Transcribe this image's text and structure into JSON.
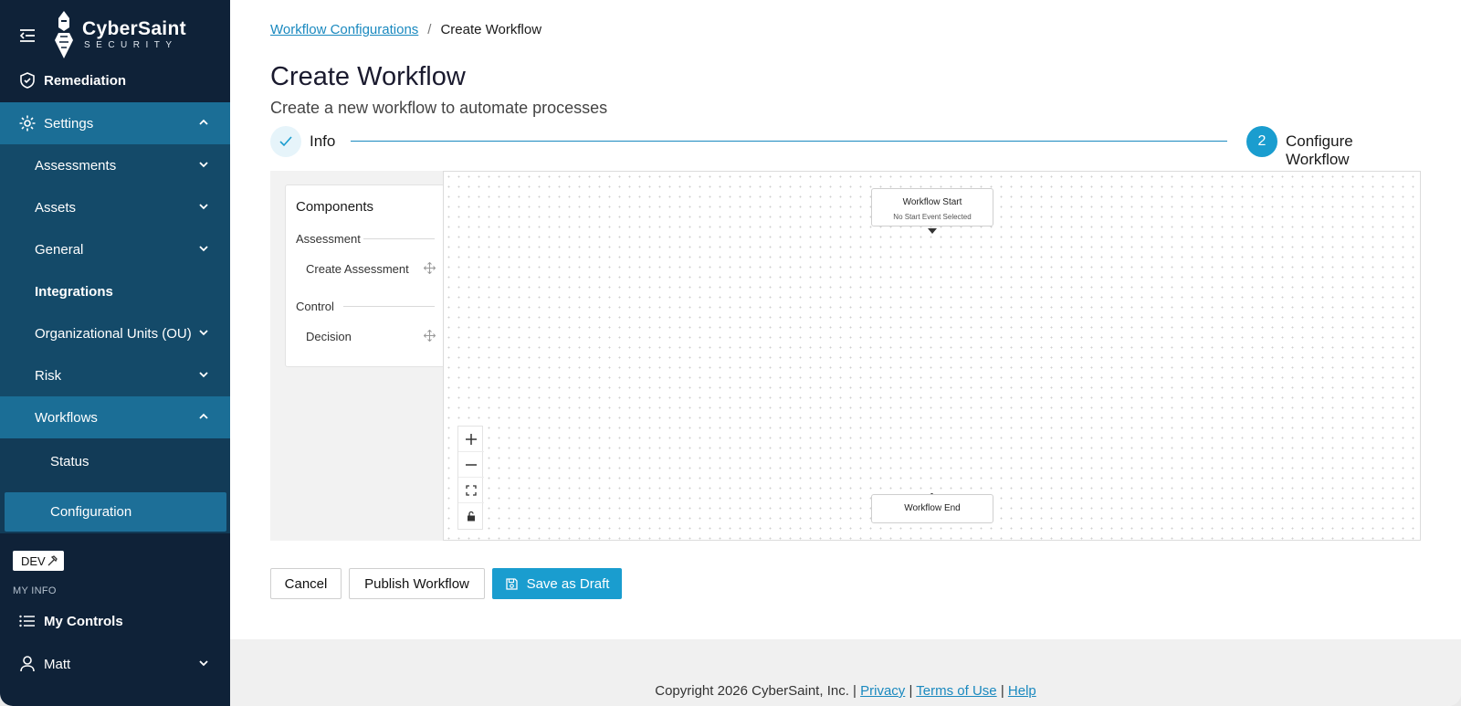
{
  "logo": {
    "name": "CyberSaint",
    "tagline": "SECURITY"
  },
  "sidebar": {
    "items": [
      {
        "label": "Remediation",
        "icon": "shield-check-icon"
      },
      {
        "label": "Settings",
        "icon": "gear-icon"
      },
      {
        "label": "Assessments"
      },
      {
        "label": "Assets"
      },
      {
        "label": "General"
      },
      {
        "label": "Integrations"
      },
      {
        "label": "Organizational Units (OU)"
      },
      {
        "label": "Risk"
      },
      {
        "label": "Workflows"
      },
      {
        "label": "Status"
      },
      {
        "label": "Configuration"
      },
      {
        "label": "My Controls",
        "icon": "list-icon"
      },
      {
        "label": "Matt",
        "icon": "user-icon"
      }
    ],
    "env_badge": "DEV",
    "section_label": "MY INFO"
  },
  "breadcrumb": {
    "parent": "Workflow Configurations",
    "separator": "/",
    "current": "Create Workflow"
  },
  "page": {
    "title": "Create Workflow",
    "subtitle": "Create a new workflow to automate processes"
  },
  "stepper": {
    "steps": [
      {
        "label": "Info",
        "state": "complete"
      },
      {
        "number": "2",
        "label": "Configure Workflow",
        "state": "active"
      }
    ]
  },
  "components": {
    "title": "Components",
    "groups": [
      {
        "category": "Assessment",
        "items": [
          "Create Assessment"
        ]
      },
      {
        "category": "Control",
        "items": [
          "Decision"
        ]
      }
    ]
  },
  "canvas": {
    "start_node": {
      "title": "Workflow Start",
      "subtitle": "No Start Event Selected"
    },
    "end_node": {
      "title": "Workflow End"
    }
  },
  "actions": {
    "cancel": "Cancel",
    "publish": "Publish Workflow",
    "save_draft": "Save as Draft"
  },
  "footer": {
    "copyright": "Copyright 2026 CyberSaint, Inc. |",
    "privacy": "Privacy",
    "sep": "|",
    "terms": "Terms of Use",
    "help": "Help"
  },
  "colors": {
    "sidebar_bg": "#0f2238",
    "accent": "#1a9dcf",
    "settings_bg": "#1b6e96",
    "link": "#1a89bf"
  }
}
